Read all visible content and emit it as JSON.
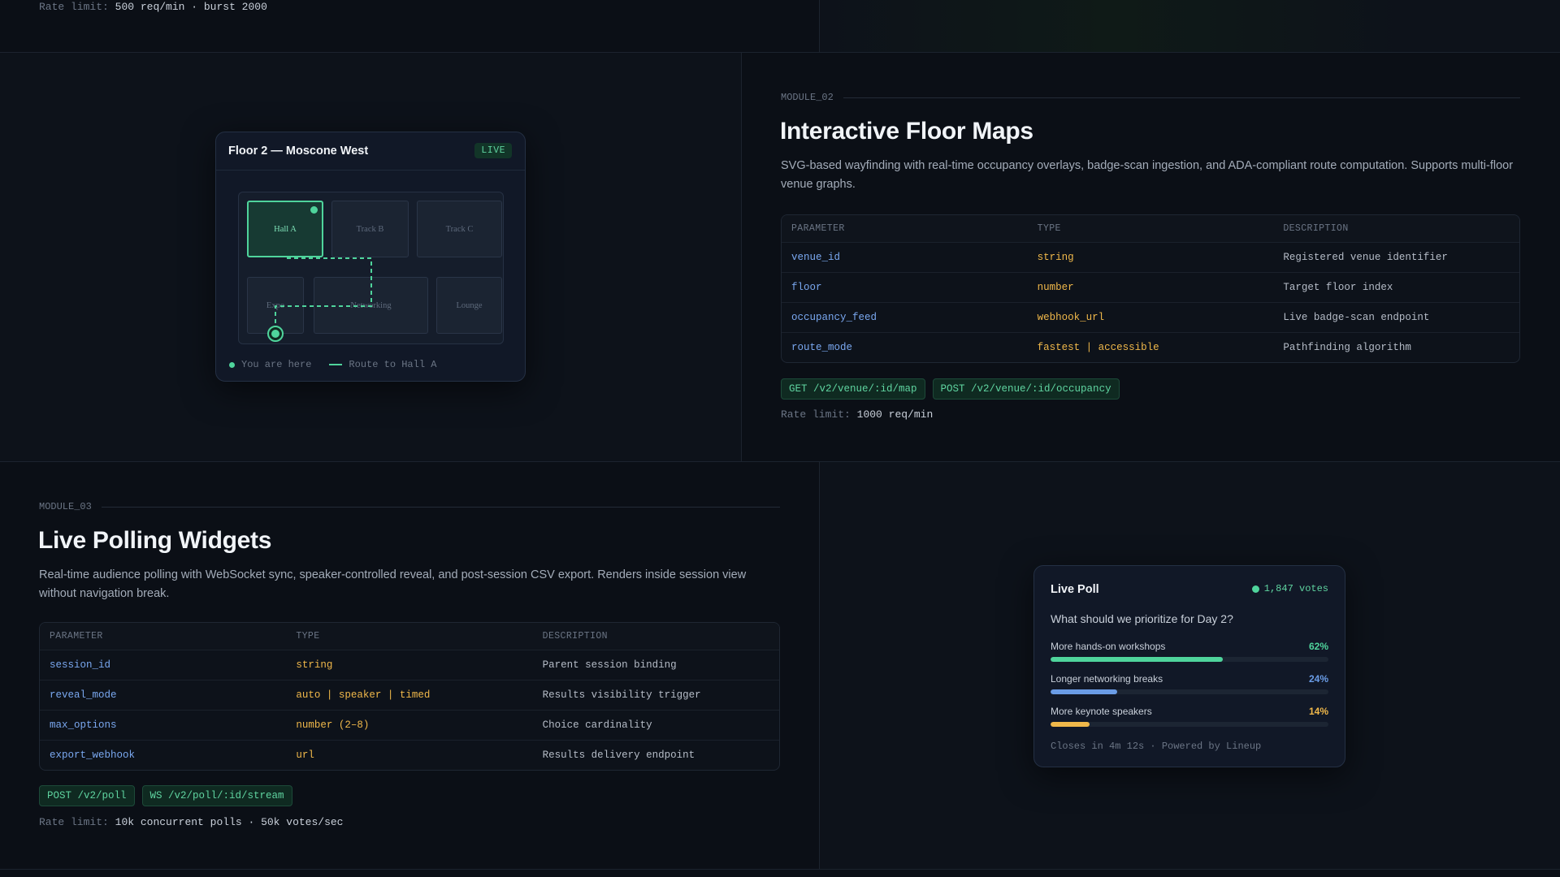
{
  "top": {
    "rate_label": "Rate limit:",
    "rate_value": "500 req/min · burst 2000"
  },
  "module2": {
    "label": "MODULE_02",
    "title": "Interactive Floor Maps",
    "description": "SVG-based wayfinding with real-time occupancy overlays, badge-scan ingestion, and ADA-compliant route computation. Supports multi-floor venue graphs.",
    "table": {
      "headers": [
        "PARAMETER",
        "TYPE",
        "DESCRIPTION"
      ],
      "rows": [
        {
          "param": "venue_id",
          "type": "string",
          "desc": "Registered venue identifier"
        },
        {
          "param": "floor",
          "type": "number",
          "desc": "Target floor index"
        },
        {
          "param": "occupancy_feed",
          "type": "webhook_url",
          "desc": "Live badge-scan endpoint"
        },
        {
          "param": "route_mode",
          "type": "fastest | accessible",
          "desc": "Pathfinding algorithm"
        }
      ]
    },
    "endpoints": [
      "GET /v2/venue/:id/map",
      "POST /v2/venue/:id/occupancy"
    ],
    "rate_label": "Rate limit:",
    "rate_value": "1000 req/min"
  },
  "floormap": {
    "title": "Floor 2 — Moscone West",
    "badge": "LIVE",
    "rooms": {
      "hall_a": "Hall A",
      "track_b": "Track B",
      "track_c": "Track C",
      "expo": "Expo",
      "networking": "Networking",
      "lounge": "Lounge"
    },
    "legend_here": "You are here",
    "legend_route": "Route to Hall A",
    "accent": "#4fd49c"
  },
  "module3": {
    "label": "MODULE_03",
    "title": "Live Polling Widgets",
    "description": "Real-time audience polling with WebSocket sync, speaker-controlled reveal, and post-session CSV export. Renders inside session view without navigation break.",
    "table": {
      "headers": [
        "PARAMETER",
        "TYPE",
        "DESCRIPTION"
      ],
      "rows": [
        {
          "param": "session_id",
          "type": "string",
          "desc": "Parent session binding"
        },
        {
          "param": "reveal_mode",
          "type": "auto | speaker | timed",
          "desc": "Results visibility trigger"
        },
        {
          "param": "max_options",
          "type": "number (2–8)",
          "desc": "Choice cardinality"
        },
        {
          "param": "export_webhook",
          "type": "url",
          "desc": "Results delivery endpoint"
        }
      ]
    },
    "endpoints": [
      "POST /v2/poll",
      "WS /v2/poll/:id/stream"
    ],
    "rate_label": "Rate limit:",
    "rate_value": "10k concurrent polls · 50k votes/sec"
  },
  "poll": {
    "title": "Live Poll",
    "votes": "1,847 votes",
    "question": "What should we prioritize for Day 2?",
    "options": [
      {
        "label": "More hands-on workshops",
        "pct_text": "62%",
        "value": 62,
        "color": "#4fd49c"
      },
      {
        "label": "Longer networking breaks",
        "pct_text": "24%",
        "value": 24,
        "color": "#6a9ce6"
      },
      {
        "label": "More keynote speakers",
        "pct_text": "14%",
        "value": 14,
        "color": "#f0b84a"
      }
    ],
    "footer": "Closes in 4m 12s · Powered by Lineup"
  }
}
